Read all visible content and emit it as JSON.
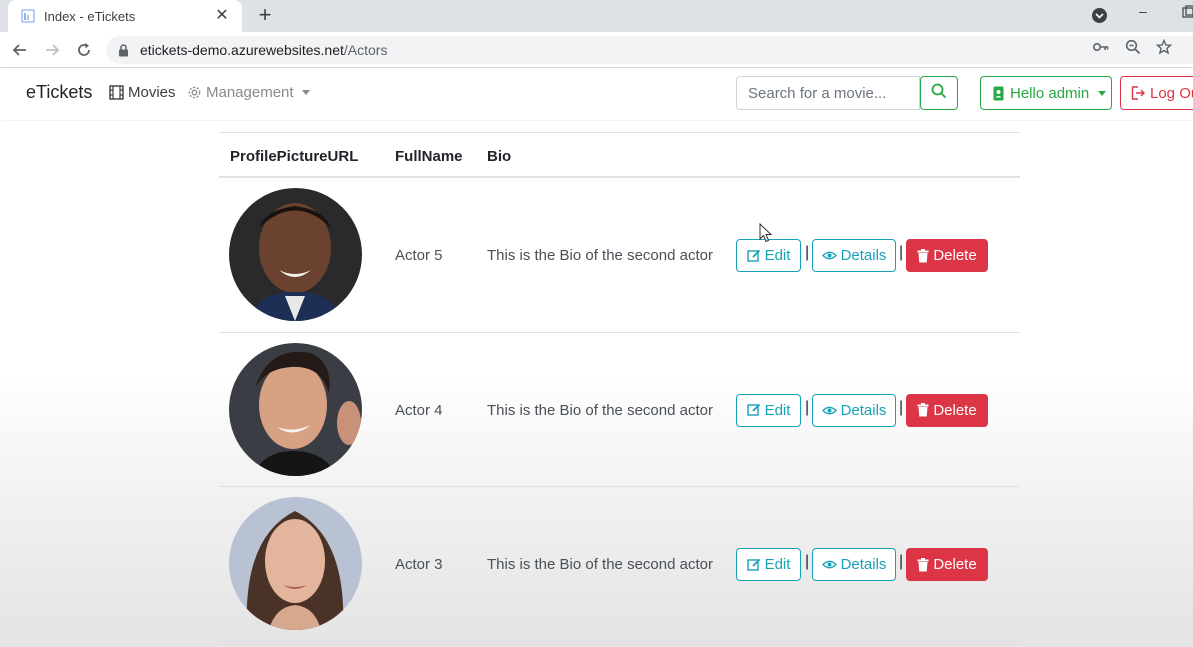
{
  "browser": {
    "tab_title": "Index - eTickets",
    "tab_close_glyph": "✕",
    "new_tab_glyph": "+",
    "minimize_glyph": "–",
    "url_host": "etickets-demo.azurewebsites.net",
    "url_path": "/Actors"
  },
  "navbar": {
    "brand": "eTickets",
    "movies_label": "Movies",
    "management_label": "Management",
    "search_placeholder": "Search for a movie...",
    "hello_label": "Hello admin",
    "logout_label": "Log Ou"
  },
  "table": {
    "headers": {
      "picture": "ProfilePictureURL",
      "name": "FullName",
      "bio": "Bio"
    },
    "rows": [
      {
        "full_name": "Actor 5",
        "bio": "This is the Bio of the second actor"
      },
      {
        "full_name": "Actor 4",
        "bio": "This is the Bio of the second actor"
      },
      {
        "full_name": "Actor 3",
        "bio": "This is the Bio of the second actor"
      }
    ],
    "actions": {
      "edit": "Edit",
      "details": "Details",
      "delete": "Delete",
      "separator": "|"
    }
  },
  "colors": {
    "success": "#28a745",
    "info": "#17a2b8",
    "danger": "#dc3545"
  },
  "icons": [
    "film-icon",
    "gear-icon",
    "search-icon",
    "user-badge-icon",
    "sign-out-icon",
    "edit-icon",
    "eye-icon",
    "trash-icon"
  ]
}
